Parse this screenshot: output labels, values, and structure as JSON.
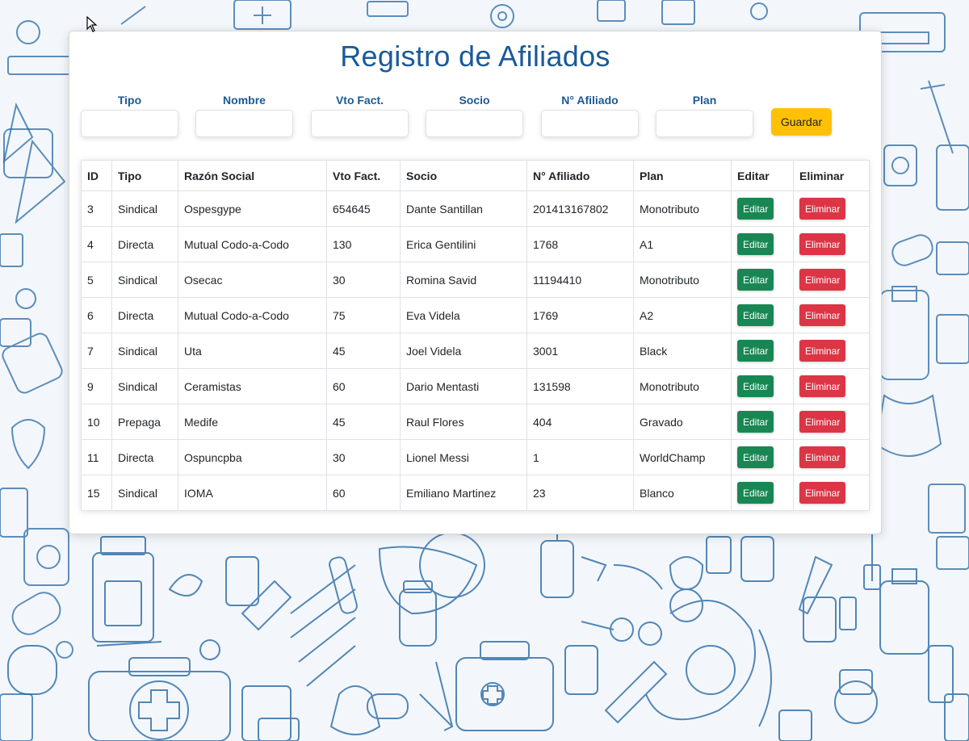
{
  "title": "Registro de Afiliados",
  "form": {
    "fields": [
      {
        "label": "Tipo",
        "value": ""
      },
      {
        "label": "Nombre",
        "value": ""
      },
      {
        "label": "Vto Fact.",
        "value": ""
      },
      {
        "label": "Socio",
        "value": ""
      },
      {
        "label": "N° Afiliado",
        "value": ""
      },
      {
        "label": "Plan",
        "value": ""
      }
    ],
    "save_label": "Guardar"
  },
  "table": {
    "headers": [
      "ID",
      "Tipo",
      "Razón Social",
      "Vto Fact.",
      "Socio",
      "N° Afiliado",
      "Plan",
      "Editar",
      "Eliminar"
    ],
    "edit_label": "Editar",
    "delete_label": "Eliminar",
    "rows": [
      {
        "id": "3",
        "tipo": "Sindical",
        "razon": "Ospesgype",
        "vto": "654645",
        "socio": "Dante Santillan",
        "afiliado": "201413167802",
        "plan": "Monotributo"
      },
      {
        "id": "4",
        "tipo": "Directa",
        "razon": "Mutual Codo-a-Codo",
        "vto": "130",
        "socio": "Erica Gentilini",
        "afiliado": "1768",
        "plan": "A1"
      },
      {
        "id": "5",
        "tipo": "Sindical",
        "razon": "Osecac",
        "vto": "30",
        "socio": "Romina Savid",
        "afiliado": "11194410",
        "plan": "Monotributo"
      },
      {
        "id": "6",
        "tipo": "Directa",
        "razon": "Mutual Codo-a-Codo",
        "vto": "75",
        "socio": "Eva Videla",
        "afiliado": "1769",
        "plan": "A2"
      },
      {
        "id": "7",
        "tipo": "Sindical",
        "razon": "Uta",
        "vto": "45",
        "socio": "Joel Videla",
        "afiliado": "3001",
        "plan": "Black"
      },
      {
        "id": "9",
        "tipo": "Sindical",
        "razon": "Ceramistas",
        "vto": "60",
        "socio": "Dario Mentasti",
        "afiliado": "131598",
        "plan": "Monotributo"
      },
      {
        "id": "10",
        "tipo": "Prepaga",
        "razon": "Medife",
        "vto": "45",
        "socio": "Raul Flores",
        "afiliado": "404",
        "plan": "Gravado"
      },
      {
        "id": "11",
        "tipo": "Directa",
        "razon": "Ospuncpba",
        "vto": "30",
        "socio": "Lionel Messi",
        "afiliado": "1",
        "plan": "WorldChamp"
      },
      {
        "id": "15",
        "tipo": "Sindical",
        "razon": "IOMA",
        "vto": "60",
        "socio": "Emiliano Martinez",
        "afiliado": "23",
        "plan": "Blanco"
      }
    ]
  },
  "colors": {
    "title": "#1b5a96",
    "save_button": "#ffc107",
    "edit_button": "#198754",
    "delete_button": "#dc3545",
    "pattern_stroke": "#2a6aa6"
  }
}
